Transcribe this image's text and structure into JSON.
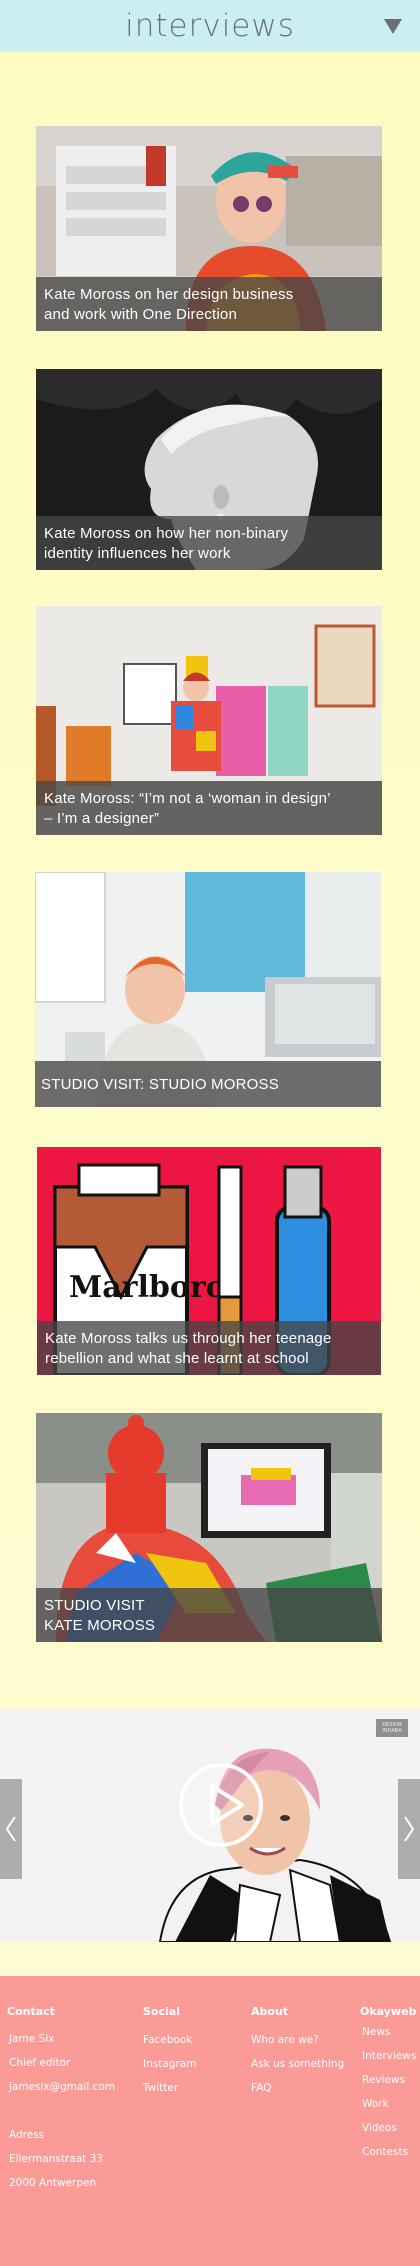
{
  "header": {
    "title": "interviews",
    "menu_icon": "triangle-down-icon"
  },
  "articles": [
    {
      "lines": [
        "Kate Moross on her design business",
        "and work with One Direction"
      ]
    },
    {
      "lines": [
        "Kate Moross on how her non-binary",
        "identity influences her work"
      ]
    },
    {
      "lines": [
        "Kate Moross: “I’m not a ‘woman in design’",
        "– I’m a designer”"
      ]
    },
    {
      "lines": [
        "STUDIO VISIT: STUDIO MOROSS"
      ]
    },
    {
      "lines": [
        "Kate Moross talks us through her teenage",
        "rebellion and what she learnt at school"
      ]
    },
    {
      "lines": [
        "STUDIO VISIT",
        "KATE MOROSS"
      ]
    }
  ],
  "video": {
    "badge": "DESIGN INDABA",
    "play_icon": "play-icon",
    "prev_icon": "chevron-left-icon",
    "next_icon": "chevron-right-icon"
  },
  "footer": {
    "contact": {
      "heading": "Contact",
      "name": "Jame Six",
      "role": "Chief editor",
      "email": "jamesix@gmail.com",
      "address_label": "Adress",
      "street": "Ellermanstraat 33",
      "city": "2000 Antwerpen"
    },
    "social": {
      "heading": "Social",
      "links": [
        "Facebook",
        "Instagram",
        "Twitter"
      ]
    },
    "about": {
      "heading": "About",
      "links": [
        "Who are we?",
        "Ask us something",
        "FAQ"
      ]
    },
    "okayweb": {
      "heading": "Okayweb",
      "links": [
        "News",
        "Interviews",
        "Reviews",
        "Work",
        "Videos",
        "Contests"
      ]
    }
  },
  "colors": {
    "header_bg": "#cbeef3",
    "footer_bg": "#fb9b98",
    "page_bg": "#fefbbf"
  }
}
